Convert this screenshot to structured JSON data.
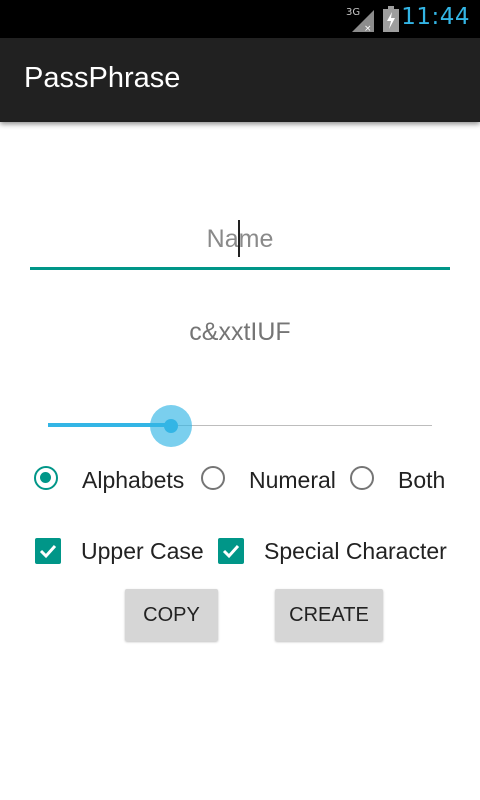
{
  "status_bar": {
    "network_label": "3G",
    "signal_icon": "signal-strength-icon",
    "battery_icon": "battery-charging-icon",
    "time": "11:44"
  },
  "app_bar": {
    "title": "PassPhrase"
  },
  "name_field": {
    "hint": "Name",
    "value": ""
  },
  "generated_passphrase": "c&xxtIUF",
  "length_slider": {
    "fraction": 0.32
  },
  "char_type": {
    "selected": "Alphabets",
    "options": [
      "Alphabets",
      "Numeral",
      "Both"
    ]
  },
  "options": {
    "upper_case": {
      "label": "Upper Case",
      "checked": true
    },
    "special_character": {
      "label": "Special Character",
      "checked": true
    }
  },
  "buttons": {
    "copy": "COPY",
    "create": "CREATE"
  },
  "colors": {
    "accent": "#009688",
    "slider": "#33b5e5",
    "action_bar": "#212121",
    "status_bar": "#000000"
  }
}
